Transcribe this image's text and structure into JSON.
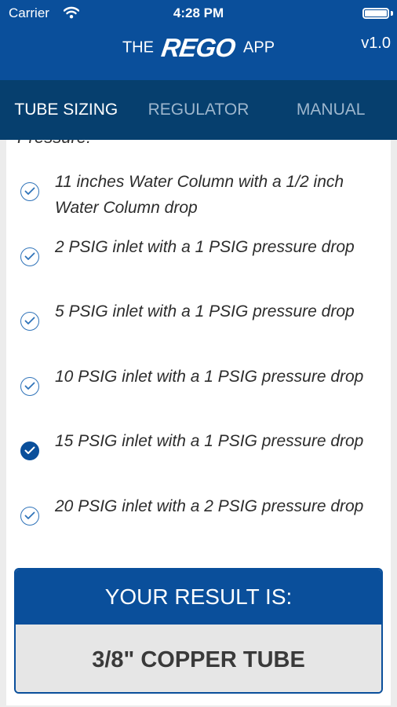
{
  "status_bar": {
    "carrier": "Carrier",
    "time": "4:28 PM",
    "wifi_icon": "wifi-icon",
    "battery_icon": "battery-icon"
  },
  "header": {
    "brand_prefix": "THE",
    "brand_logo": "REGO",
    "brand_suffix": "APP",
    "version": "v1.0",
    "color": "#0a4f9b"
  },
  "tabs": [
    {
      "label": "TUBE SIZING",
      "active": true
    },
    {
      "label": "REGULATOR",
      "active": false
    },
    {
      "label": "MANUAL",
      "active": false
    }
  ],
  "options": {
    "partial_heading": "Pressure:",
    "items": [
      {
        "label": "11 inches Water Column with a 1/2 inch Water Column drop",
        "selected": false
      },
      {
        "label": "2 PSIG inlet with a 1 PSIG pressure drop",
        "selected": false
      },
      {
        "label": "5 PSIG inlet with a 1 PSIG pressure drop",
        "selected": false
      },
      {
        "label": "10 PSIG inlet with a 1 PSIG pressure drop",
        "selected": false
      },
      {
        "label": "15 PSIG inlet with a 1 PSIG pressure drop",
        "selected": true
      },
      {
        "label": "20 PSIG inlet with a 2 PSIG pressure drop",
        "selected": false
      }
    ],
    "check_icon": "check-circle-icon"
  },
  "result": {
    "heading": "YOUR RESULT IS:",
    "value": "3/8\" COPPER TUBE"
  }
}
